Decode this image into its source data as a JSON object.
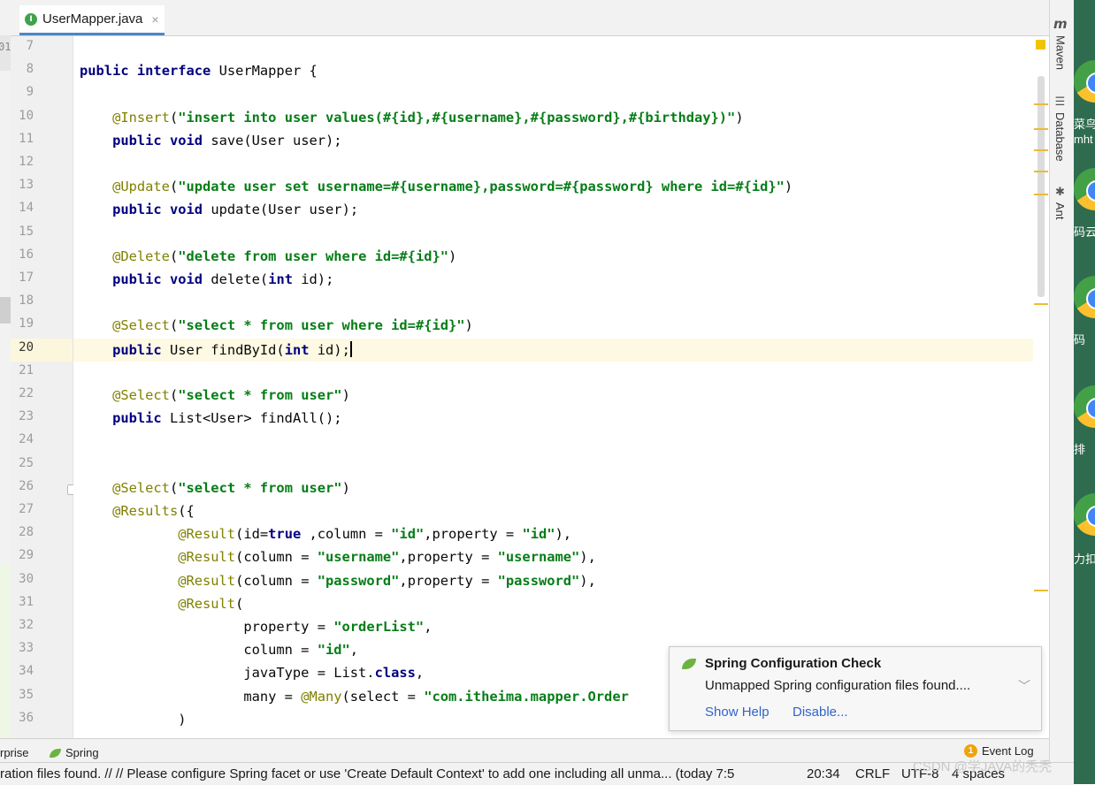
{
  "tab": {
    "icon_letter": "I",
    "label": "UserMapper.java",
    "close": "×"
  },
  "left_strip_text": "01",
  "code_lines": [
    {
      "num": "7",
      "segments": []
    },
    {
      "num": "8",
      "segments": [
        {
          "t": "kw",
          "v": "public"
        },
        {
          "t": "pl",
          "v": " "
        },
        {
          "t": "kw",
          "v": "interface"
        },
        {
          "t": "pl",
          "v": " UserMapper {"
        }
      ]
    },
    {
      "num": "9",
      "segments": []
    },
    {
      "num": "10",
      "segments": [
        {
          "t": "pl",
          "v": "    "
        },
        {
          "t": "an",
          "v": "@Insert"
        },
        {
          "t": "pl",
          "v": "("
        },
        {
          "t": "st",
          "v": "\"insert into user values(#{id},#{username},#{password},#{birthday})\""
        },
        {
          "t": "pl",
          "v": ")"
        }
      ]
    },
    {
      "num": "11",
      "segments": [
        {
          "t": "pl",
          "v": "    "
        },
        {
          "t": "kw",
          "v": "public"
        },
        {
          "t": "pl",
          "v": " "
        },
        {
          "t": "kw",
          "v": "void"
        },
        {
          "t": "pl",
          "v": " save(User user);"
        }
      ]
    },
    {
      "num": "12",
      "segments": []
    },
    {
      "num": "13",
      "segments": [
        {
          "t": "pl",
          "v": "    "
        },
        {
          "t": "an",
          "v": "@Update"
        },
        {
          "t": "pl",
          "v": "("
        },
        {
          "t": "st",
          "v": "\"update user set username=#{username},password=#{password} where id=#{id}\""
        },
        {
          "t": "pl",
          "v": ")"
        }
      ]
    },
    {
      "num": "14",
      "segments": [
        {
          "t": "pl",
          "v": "    "
        },
        {
          "t": "kw",
          "v": "public"
        },
        {
          "t": "pl",
          "v": " "
        },
        {
          "t": "kw",
          "v": "void"
        },
        {
          "t": "pl",
          "v": " update(User user);"
        }
      ]
    },
    {
      "num": "15",
      "segments": []
    },
    {
      "num": "16",
      "segments": [
        {
          "t": "pl",
          "v": "    "
        },
        {
          "t": "an",
          "v": "@Delete"
        },
        {
          "t": "pl",
          "v": "("
        },
        {
          "t": "st",
          "v": "\"delete from user where id=#{id}\""
        },
        {
          "t": "pl",
          "v": ")"
        }
      ]
    },
    {
      "num": "17",
      "segments": [
        {
          "t": "pl",
          "v": "    "
        },
        {
          "t": "kw",
          "v": "public"
        },
        {
          "t": "pl",
          "v": " "
        },
        {
          "t": "kw",
          "v": "void"
        },
        {
          "t": "pl",
          "v": " delete("
        },
        {
          "t": "kw",
          "v": "int"
        },
        {
          "t": "pl",
          "v": " id);"
        }
      ]
    },
    {
      "num": "18",
      "segments": []
    },
    {
      "num": "19",
      "segments": [
        {
          "t": "pl",
          "v": "    "
        },
        {
          "t": "an",
          "v": "@Select"
        },
        {
          "t": "pl",
          "v": "("
        },
        {
          "t": "st",
          "v": "\"select * from user where id=#{id}\""
        },
        {
          "t": "pl",
          "v": ")"
        }
      ]
    },
    {
      "num": "20",
      "segments": [
        {
          "t": "pl",
          "v": "    "
        },
        {
          "t": "kw",
          "v": "public"
        },
        {
          "t": "pl",
          "v": " User findById("
        },
        {
          "t": "kw",
          "v": "int"
        },
        {
          "t": "pl",
          "v": " id);"
        },
        {
          "t": "caret",
          "v": ""
        }
      ]
    },
    {
      "num": "21",
      "segments": []
    },
    {
      "num": "22",
      "segments": [
        {
          "t": "pl",
          "v": "    "
        },
        {
          "t": "an",
          "v": "@Select"
        },
        {
          "t": "pl",
          "v": "("
        },
        {
          "t": "st",
          "v": "\"select * from user\""
        },
        {
          "t": "pl",
          "v": ")"
        }
      ]
    },
    {
      "num": "23",
      "segments": [
        {
          "t": "pl",
          "v": "    "
        },
        {
          "t": "kw",
          "v": "public"
        },
        {
          "t": "pl",
          "v": " List<User> findAll();"
        }
      ]
    },
    {
      "num": "24",
      "segments": []
    },
    {
      "num": "25",
      "segments": []
    },
    {
      "num": "26",
      "segments": [
        {
          "t": "pl",
          "v": "    "
        },
        {
          "t": "an",
          "v": "@Select"
        },
        {
          "t": "pl",
          "v": "("
        },
        {
          "t": "st",
          "v": "\"select * from user\""
        },
        {
          "t": "pl",
          "v": ")"
        }
      ]
    },
    {
      "num": "27",
      "segments": [
        {
          "t": "pl",
          "v": "    "
        },
        {
          "t": "an",
          "v": "@Results"
        },
        {
          "t": "pl",
          "v": "({"
        }
      ]
    },
    {
      "num": "28",
      "segments": [
        {
          "t": "pl",
          "v": "            "
        },
        {
          "t": "an",
          "v": "@Result"
        },
        {
          "t": "pl",
          "v": "(id="
        },
        {
          "t": "kw",
          "v": "true"
        },
        {
          "t": "pl",
          "v": " ,column = "
        },
        {
          "t": "st",
          "v": "\"id\""
        },
        {
          "t": "pl",
          "v": ",property = "
        },
        {
          "t": "st",
          "v": "\"id\""
        },
        {
          "t": "pl",
          "v": "),"
        }
      ]
    },
    {
      "num": "29",
      "segments": [
        {
          "t": "pl",
          "v": "            "
        },
        {
          "t": "an",
          "v": "@Result"
        },
        {
          "t": "pl",
          "v": "(column = "
        },
        {
          "t": "st",
          "v": "\"username\""
        },
        {
          "t": "pl",
          "v": ",property = "
        },
        {
          "t": "st",
          "v": "\"username\""
        },
        {
          "t": "pl",
          "v": "),"
        }
      ]
    },
    {
      "num": "30",
      "segments": [
        {
          "t": "pl",
          "v": "            "
        },
        {
          "t": "an",
          "v": "@Result"
        },
        {
          "t": "pl",
          "v": "(column = "
        },
        {
          "t": "st",
          "v": "\"password\""
        },
        {
          "t": "pl",
          "v": ",property = "
        },
        {
          "t": "st",
          "v": "\"password\""
        },
        {
          "t": "pl",
          "v": "),"
        }
      ]
    },
    {
      "num": "31",
      "segments": [
        {
          "t": "pl",
          "v": "            "
        },
        {
          "t": "an",
          "v": "@Result"
        },
        {
          "t": "pl",
          "v": "("
        }
      ]
    },
    {
      "num": "32",
      "segments": [
        {
          "t": "pl",
          "v": "                    property = "
        },
        {
          "t": "st",
          "v": "\"orderList\""
        },
        {
          "t": "pl",
          "v": ","
        }
      ]
    },
    {
      "num": "33",
      "segments": [
        {
          "t": "pl",
          "v": "                    column = "
        },
        {
          "t": "st",
          "v": "\"id\""
        },
        {
          "t": "pl",
          "v": ","
        }
      ]
    },
    {
      "num": "34",
      "segments": [
        {
          "t": "pl",
          "v": "                    javaType = List."
        },
        {
          "t": "kw",
          "v": "class"
        },
        {
          "t": "pl",
          "v": ","
        }
      ]
    },
    {
      "num": "35",
      "segments": [
        {
          "t": "pl",
          "v": "                    many = "
        },
        {
          "t": "an",
          "v": "@Many"
        },
        {
          "t": "pl",
          "v": "(select = "
        },
        {
          "t": "st",
          "v": "\"com.itheima.mapper.Order"
        }
      ]
    },
    {
      "num": "36",
      "segments": [
        {
          "t": "pl",
          "v": "            )"
        }
      ]
    }
  ],
  "right_tools": {
    "maven_icon": "m",
    "maven": "Maven",
    "database": "Database",
    "ant": "Ant"
  },
  "desktop_labels": [
    "菜鸟教",
    "mht",
    "码云",
    "码",
    "排",
    "力扣"
  ],
  "bottom_tools": {
    "enterprise": "rprise",
    "spring": "Spring",
    "event_count": "1",
    "event_log": "Event Log"
  },
  "status": {
    "message": "ration files found. // // Please configure Spring facet or use 'Create Default Context' to add one including all unma... (today 7:5",
    "time": "20:34",
    "line_sep": "CRLF",
    "encoding": "UTF-8",
    "indent": "4 spaces"
  },
  "watermark": "CSDN @学JAVA的秃秃",
  "notification": {
    "title": "Spring Configuration Check",
    "message": "Unmapped Spring configuration files found....",
    "show_help": "Show Help",
    "disable": "Disable..."
  },
  "colors": {
    "keyword": "#000080",
    "annotation": "#808000",
    "string": "#067d17",
    "link": "#2f65ca",
    "accent": "#4a88c7"
  }
}
